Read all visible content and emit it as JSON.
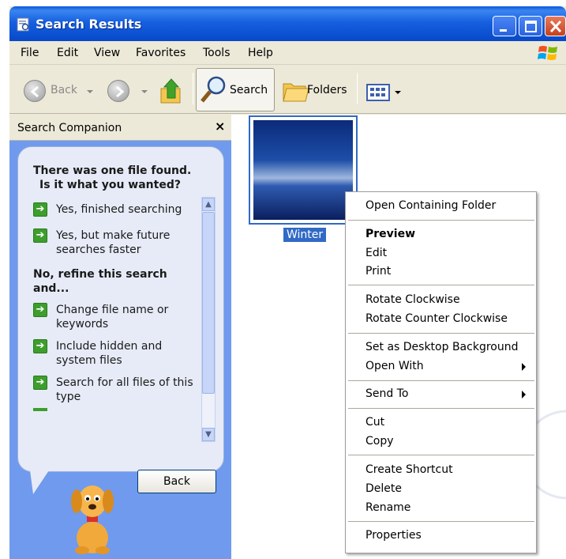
{
  "window": {
    "title": "Search Results"
  },
  "menubar": [
    "File",
    "Edit",
    "View",
    "Favorites",
    "Tools",
    "Help"
  ],
  "toolbar": {
    "back_label": "Back",
    "search_label": "Search",
    "folders_label": "Folders"
  },
  "search_companion": {
    "title": "Search Companion",
    "close_glyph": "×",
    "question_line1": "There was one file found.",
    "question_line2": "Is it what you wanted?",
    "option1": "Yes, finished searching",
    "option2_line1": "Yes, but make future",
    "option2_line2": "searches faster",
    "refine_line1": "No, refine this search",
    "refine_line2": "and...",
    "refine1_line1": "Change file name or",
    "refine1_line2": "keywords",
    "refine2_line1": "Include hidden and",
    "refine2_line2": "system files",
    "refine3_line1": "Search for all files of this",
    "refine3_line2": "type",
    "back_button": "Back"
  },
  "results": {
    "file_label": "Winter"
  },
  "context_menu": {
    "open_containing_folder": "Open Containing Folder",
    "preview": "Preview",
    "edit": "Edit",
    "print": "Print",
    "rotate_cw": "Rotate Clockwise",
    "rotate_ccw": "Rotate Counter Clockwise",
    "set_background": "Set as Desktop Background",
    "open_with": "Open With",
    "send_to": "Send To",
    "cut": "Cut",
    "copy": "Copy",
    "create_shortcut": "Create Shortcut",
    "delete": "Delete",
    "rename": "Rename",
    "properties": "Properties"
  },
  "colors": {
    "titlebar": "#0a4fd0",
    "selection": "#316ac5",
    "pane": "#6f9aee"
  }
}
